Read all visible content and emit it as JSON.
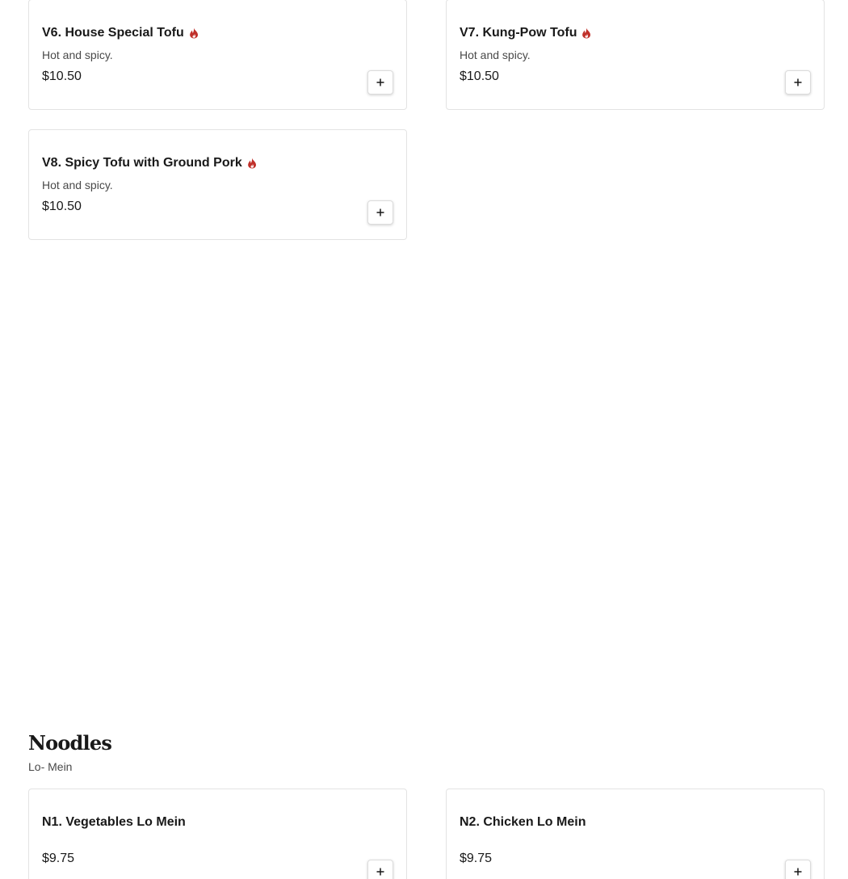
{
  "items": [
    {
      "name": "V6. House Special Tofu",
      "spicy": true,
      "description": "Hot and spicy.",
      "price": "$10.50",
      "add_icon": "plus-icon"
    },
    {
      "name": "V7. Kung-Pow Tofu",
      "spicy": true,
      "description": "Hot and spicy.",
      "price": "$10.50",
      "add_icon": "plus-icon"
    },
    {
      "name": "V8. Spicy Tofu with Ground Pork",
      "spicy": true,
      "description": "Hot and spicy.",
      "price": "$10.50",
      "add_icon": "plus-icon"
    }
  ],
  "noodles": {
    "title": "Noodles",
    "subtitle": "Lo- Mein",
    "items": [
      {
        "name": "N1. Vegetables Lo Mein",
        "price": "$9.75",
        "add_icon": "plus-icon"
      },
      {
        "name": "N2. Chicken Lo Mein",
        "price": "$9.75",
        "add_icon": "plus-icon"
      }
    ]
  },
  "colors": {
    "spicy_icon": "#c0302a",
    "card_border": "#e3e3e3",
    "text_primary": "#191919",
    "text_secondary": "#494949"
  }
}
